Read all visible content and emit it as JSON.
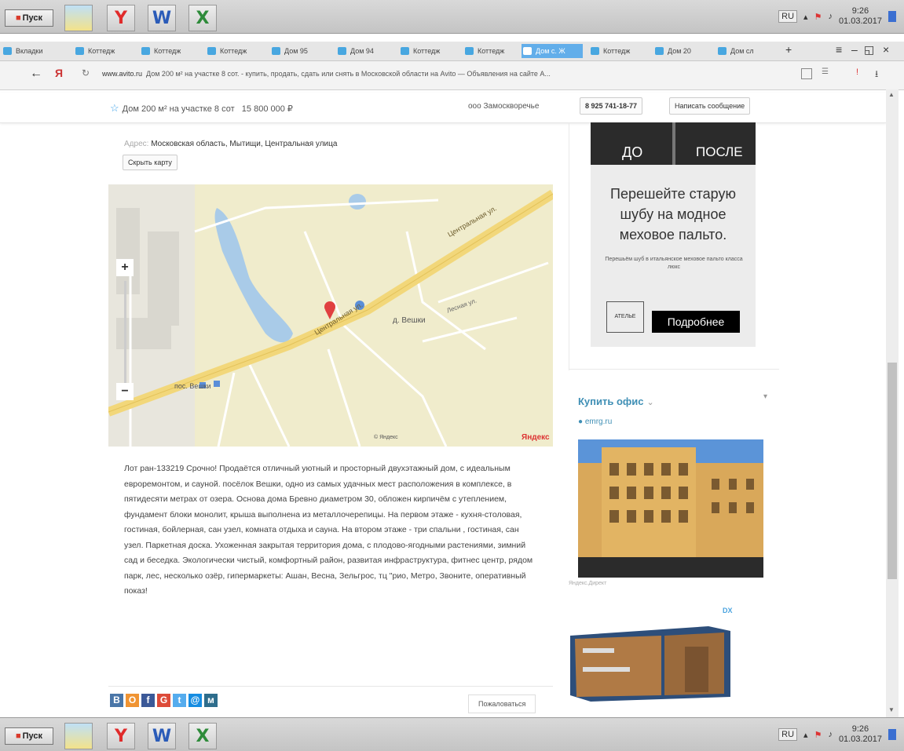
{
  "taskbar": {
    "start_label": "Пуск",
    "apps": [
      "Y",
      "W",
      "X"
    ],
    "lang": "RU",
    "time": "9:26",
    "date": "01.03.2017"
  },
  "browser": {
    "tabs": [
      "Вкладки",
      "Коттедж",
      "Коттедж",
      "Коттедж",
      "Дом 95",
      "Дом 94",
      "Коттедж",
      "Коттедж",
      "Дом с. Ж",
      "Коттедж",
      "Дом 20",
      "Дом сл"
    ],
    "active_tab_index": 8,
    "address_host": "www.avito.ru",
    "address_title": "Дом 200 м² на участке 8 сот. - купить, продать, сдать или снять в Московской области на Avito — Объявления на сайте А..."
  },
  "header": {
    "title": "Дом 200 м² на участке 8 сот",
    "price": "15 800 000 ₽",
    "seller": "ооо Замоскворечье",
    "phone": "8 925 741-18-77",
    "message_button": "Написать сообщение"
  },
  "listing": {
    "address_label": "Адрес:",
    "address": "Московская область, Мытищи, Центральная улица",
    "hide_map": "Скрыть карту",
    "description": "Лот ран-133219 Срочно! Продаётся отличный уютный и просторный двухэтажный дом, с идеальным евроремонтом, и сауной. посёлок Вешки, одно из самых удачных мест расположения в комплексе, в пятидесяти метрах от озера. Основа дома Бревно диаметром 30, обложен кирпичём с утеплением, фундамент блоки монолит, крыша выполнена из металлочерепицы. На первом этаже - кухня-столовая, гостиная, бойлерная, сан узел, комната отдыха и сауна. На втором этаже - три спальни , гостиная, сан узел. Паркетная доска. Ухоженная закрытая территория дома, с плодово-ягодными растениями, зимний сад и беседка. Экологически чистый, комфортный район, развитая инфраструктура, фитнес центр, рядом парк, лес, несколько озёр, гипермаркеты: Ашан, Весна, Зельгрос, тц \"рио, Метро, Звоните, оперативный показ!",
    "share_icons": [
      "В",
      "О",
      "f",
      "G",
      "t",
      "@",
      "м"
    ],
    "complain": "Пожаловаться"
  },
  "map": {
    "street_label_1": "Центральная ул.",
    "street_label_2": "Центральная ул.",
    "village_label": "д. Вешки",
    "street_label_3": "Лесная ул.",
    "village_label_2": "пос. Вешки",
    "zoom_in": "+",
    "zoom_out": "−",
    "attribution": "© Яндекс",
    "logo": "Яндекс"
  },
  "ad1": {
    "do": "ДО",
    "posle": "ПОСЛЕ",
    "headline": "Перешейте старую шубу на модное меховое пальто.",
    "small_text": "Перешьём шуб в итальянское меховое пальто класса люкс",
    "logo_text": "АТЕЛЬЕ",
    "more_button": "Подробнее"
  },
  "ad2": {
    "title": "Купить офис",
    "source": "emrg.ru",
    "caption": "Яндекс.Директ"
  },
  "ad3": {
    "badge": "DX"
  }
}
